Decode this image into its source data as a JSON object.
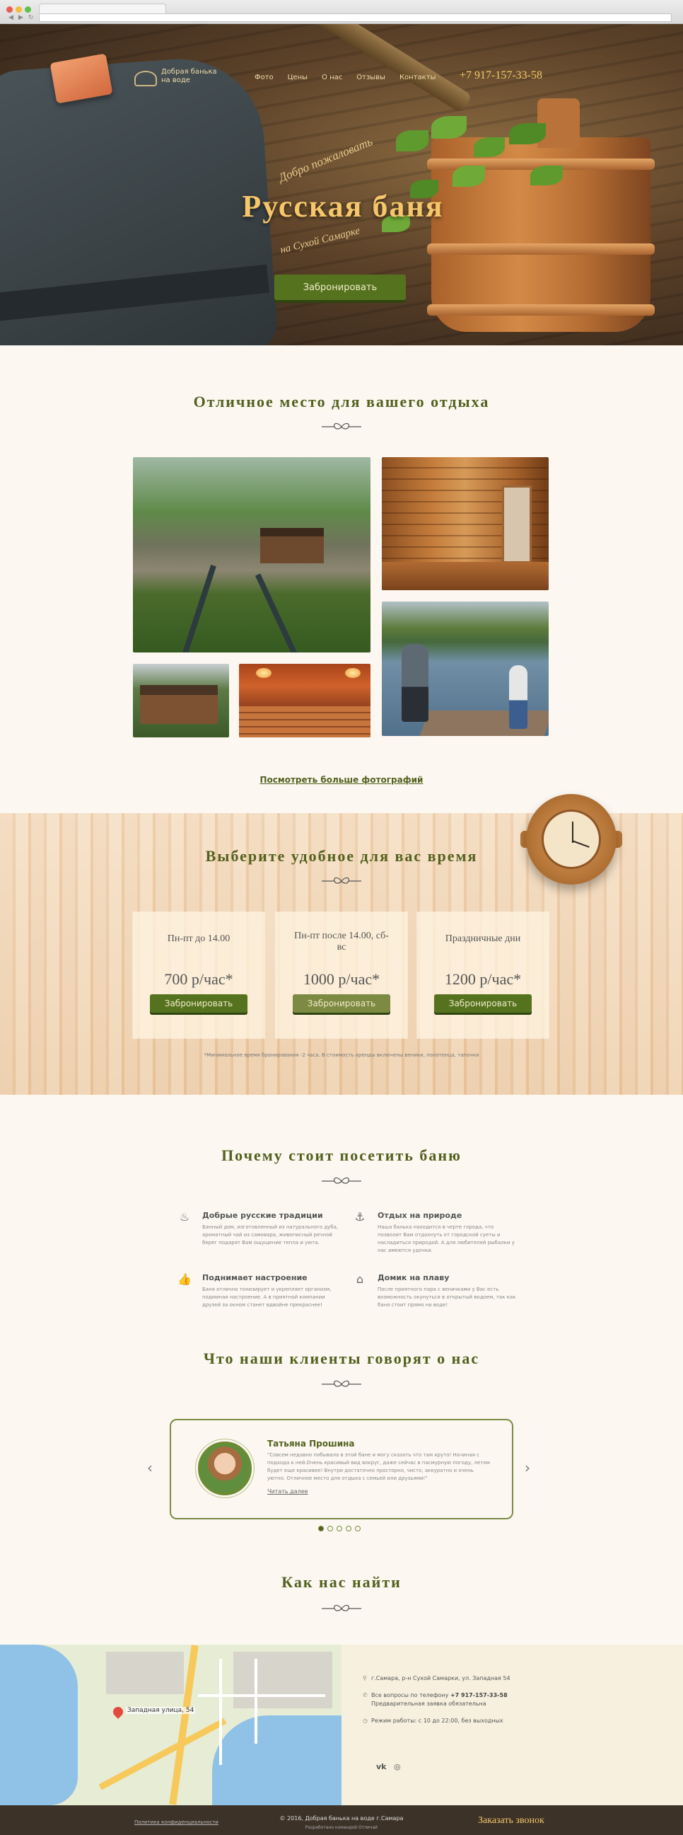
{
  "nav": {
    "logo_line1": "Добрая банька",
    "logo_line2": "на воде",
    "menu": [
      "Фото",
      "Цены",
      "О нас",
      "Отзывы",
      "Контакты"
    ],
    "phone": "+7 917-157-33-58"
  },
  "hero": {
    "welcome": "Добро пожаловать",
    "title": "Русская баня",
    "subtitle": "на Сухой Самарке",
    "book_button": "Забронировать"
  },
  "gallery": {
    "title": "Отличное место для вашего отдыха",
    "more_link": "Посмотреть больше фотографий"
  },
  "prices": {
    "title": "Выберите удобное для вас время",
    "cards": [
      {
        "name": "Пн-пт до 14.00",
        "price": "700 р/час*",
        "button": "Забронировать"
      },
      {
        "name": "Пн-пт после 14.00, сб-вс",
        "price": "1000 р/час*",
        "button": "Забронировать"
      },
      {
        "name": "Праздничные дни",
        "price": "1200 р/час*",
        "button": "Забронировать"
      }
    ],
    "note": "*Минимальное время бронирования -2 часа. В стоимость аренды включены веники, полотенца, тапочки"
  },
  "why": {
    "title": "Почему стоит посетить баню",
    "features": [
      {
        "icon": "samovar-icon",
        "title": "Добрые русские традиции",
        "text": "Банный дом, изготовленный из натурального дуба, ароматный чай из самовара, живописный речной берег подарят Вам ощущение тепла и уюта."
      },
      {
        "icon": "fishing-icon",
        "title": "Отдых на природе",
        "text": "Наша банька находится в черте города, что позволит Вам отдохнуть от городской суеты и насладиться природой. А для любителей рыбалки у нас имеются удочки."
      },
      {
        "icon": "thumb-up-icon",
        "title": "Поднимает настроение",
        "text": "Баня отлично тонизирует и укрепляет организм, подминая настроение. А в приятной компании друзей за окном станет вдвойне прекраснее!"
      },
      {
        "icon": "house-boat-icon",
        "title": "Домик на плаву",
        "text": "После приятного пара с веничками у Вас есть возможность окунуться в открытый водоем, так как баня стоит прямо на воде!"
      }
    ]
  },
  "reviews": {
    "title": "Что наши клиенты говорят о нас",
    "name": "Татьяна Прошина",
    "text": "\"Совсем недавно побывала в этой бане и могу сказать что там круто! Начиная с подхода к ней.Очень красивый вид вокруг, даже сейчас в пасмурную погоду, летом будет еще красивее! Внутри достаточно просторно, чисто, аккуратно и очень уютно. Отличное место для отдыха с семьей или друзьями!\"",
    "more": "Читать далее",
    "total_slides": 5,
    "active_slide": 1
  },
  "contacts": {
    "title": "Как нас найти",
    "map_label": "Западная улица, 54",
    "address": "г.Самара, р-н Сухой Самарки, ул. Западная 54",
    "phone_label": "Все вопросы по телефону",
    "phone": "+7 917-157-33-58",
    "phone_note": "Предварительная заявка обязательна",
    "hours": "Режим работы: с 10 до 22:00, без выходных",
    "social": [
      "vk",
      "instagram"
    ]
  },
  "footer": {
    "privacy": "Политика конфиденциальности",
    "copyright": "© 2016, Добрая банька на воде г.Самара",
    "developer": "Разработано командой Отличай",
    "callback": "Заказать звонок"
  },
  "colors": {
    "accent_green": "#55731f",
    "title_green": "#53611f",
    "gold": "#f5c66a",
    "footer": "#3d3228"
  }
}
